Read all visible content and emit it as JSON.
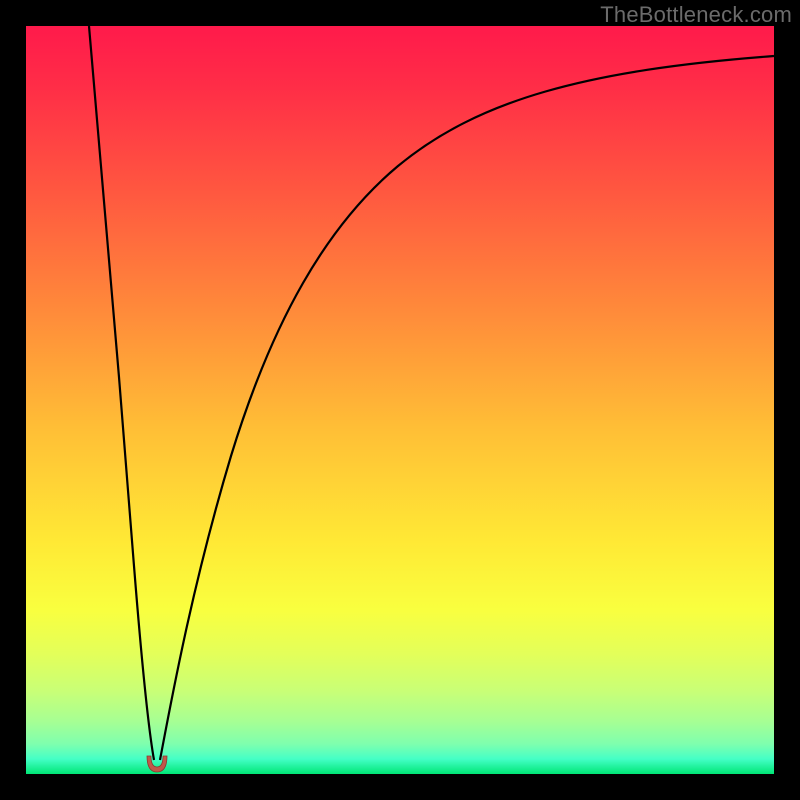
{
  "watermark": "TheBottleneck.com",
  "colors": {
    "background": "#000000",
    "gradient_top": "#ff1a4b",
    "gradient_bottom": "#00e676",
    "curve": "#000000",
    "dip_fill": "#c1584a"
  },
  "chart_data": {
    "type": "line",
    "title": "",
    "xlabel": "",
    "ylabel": "",
    "xlim": [
      0,
      100
    ],
    "ylim": [
      0,
      100
    ],
    "note": "Bottleneck-style plot: two curves descending to a single minimum near x≈17 (y≈0) and rising again; background is a vertical heat gradient red→green with a small red U-shaped marker at the minimum.",
    "series": [
      {
        "name": "left-branch",
        "x": [
          8.5,
          10,
          12,
          14,
          16,
          17,
          17.5
        ],
        "values": [
          100,
          84,
          62,
          40,
          18,
          4,
          1.5
        ]
      },
      {
        "name": "right-branch",
        "x": [
          17.5,
          18,
          20,
          24,
          30,
          38,
          48,
          60,
          74,
          88,
          100
        ],
        "values": [
          1.5,
          4,
          18,
          38,
          56,
          68,
          77,
          84,
          89,
          92,
          94
        ]
      }
    ],
    "minimum_marker": {
      "x": 17.5,
      "y": 1.5,
      "shape": "u",
      "color": "#c1584a"
    }
  }
}
